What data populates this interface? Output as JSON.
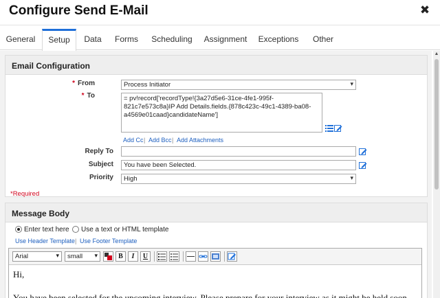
{
  "dialog": {
    "title": "Configure Send E-Mail",
    "close_glyph": "✖"
  },
  "tabs": [
    {
      "label": "General"
    },
    {
      "label": "Setup"
    },
    {
      "label": "Data"
    },
    {
      "label": "Forms"
    },
    {
      "label": "Scheduling"
    },
    {
      "label": "Assignment"
    },
    {
      "label": "Exceptions"
    },
    {
      "label": "Other"
    }
  ],
  "active_tab": "Setup",
  "email_config": {
    "heading": "Email Configuration",
    "from": {
      "label": "From",
      "value": "Process Initiator"
    },
    "to": {
      "label": "To",
      "value": "= pv!record['recordType!{3a27d5e6-31ce-4fe1-995f-\n821c7e573c8a}IP Add Details.fields.{878c423c-49c1-4389-ba08-\na4569e01caad}candidateName']"
    },
    "links": {
      "add_cc": "Add Cc",
      "add_bcc": "Add Bcc",
      "add_attachments": "Add Attachments",
      "separator": "|"
    },
    "reply_to": {
      "label": "Reply To",
      "value": ""
    },
    "subject": {
      "label": "Subject",
      "value": "You have been Selected."
    },
    "priority": {
      "label": "Priority",
      "value": "High"
    },
    "required_mark": "*",
    "required_note": "*Required"
  },
  "message_body": {
    "heading": "Message Body",
    "option_enter_text": "Enter text here",
    "option_template": "Use a text or HTML template",
    "selected_option": "Enter text here",
    "header_template_link": "Use Header Template",
    "footer_template_link": "Use Footer Template",
    "separator": "|",
    "font_family": "Arial",
    "font_size": "small",
    "bold": "B",
    "italic": "I",
    "underline": "U",
    "body_lines": [
      "Hi,",
      "",
      "You have been selected for the upcoming interview. Please prepare for your interview as it might be held soon"
    ]
  },
  "colors": {
    "accent": "#1e6fd9",
    "required": "#d0021b",
    "link": "#1d5fbf"
  }
}
